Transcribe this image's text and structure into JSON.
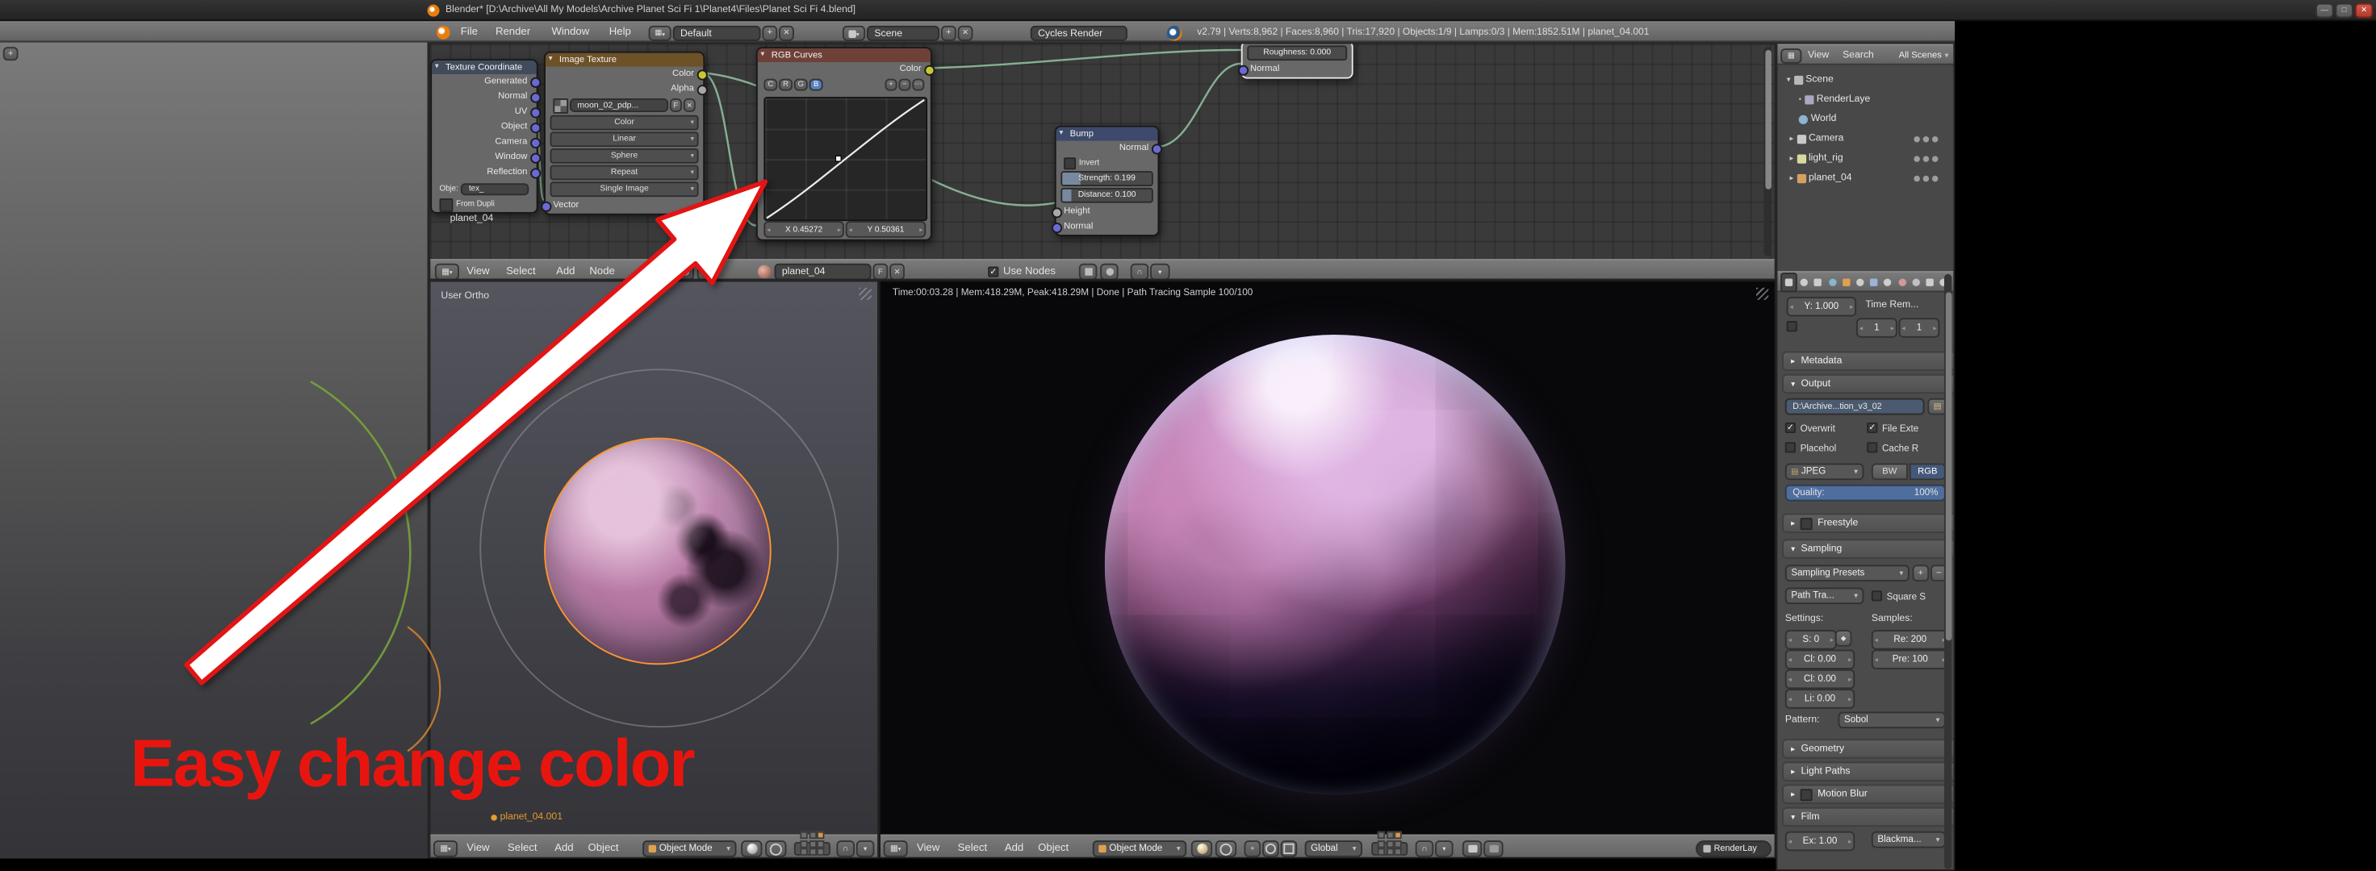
{
  "icons": {
    "close": "✕",
    "plus": "+",
    "minus": "−",
    "check": "✓",
    "minimize": "—",
    "maximize": "□",
    "panel_open": "▼",
    "panel_closed": "►",
    "tri_down": "▾",
    "tri_right": "▸",
    "fake_user": "F",
    "magnet": "∩",
    "dots": "⋯",
    "dot": "•",
    "editor": "▦",
    "folder": "▤",
    "image_file": "▤",
    "seed": "◆",
    "corner": "◢"
  },
  "titlebar": {
    "title": "Blender* [D:\\Archive\\All My Models\\Archive Planet Sci Fi 1\\Planet4\\Files\\Planet Sci Fi 4.blend]"
  },
  "topbar": {
    "menus": [
      "File",
      "Render",
      "Window",
      "Help"
    ],
    "layout": "Default",
    "scene": "Scene",
    "engine": "Cycles Render",
    "stats": "v2.79 | Verts:8,962 | Faces:8,960 | Tris:17,920 | Objects:1/9 | Lamps:0/3 | Mem:1852.51M | planet_04.001"
  },
  "node_editor": {
    "backdrop_label": "planet_04",
    "header": {
      "menus": [
        "View",
        "Select",
        "Add",
        "Node"
      ],
      "material_name": "planet_04",
      "use_nodes": "Use Nodes"
    },
    "nodes": {
      "texture_coordinate": {
        "title": "Texture Coordinate",
        "outputs": [
          "Generated",
          "Normal",
          "UV",
          "Object",
          "Camera",
          "Window",
          "Reflection"
        ],
        "object_label": "Obje:",
        "object_value": "tex_",
        "from_dupli": "From Dupli"
      },
      "image_texture": {
        "title": "Image Texture",
        "outputs": [
          "Color",
          "Alpha"
        ],
        "image_name": "moon_02_pdp...",
        "color_space": "Color",
        "interpolation": "Linear",
        "projection": "Sphere",
        "extension": "Repeat",
        "source": "Single Image",
        "inputs": [
          "Vector"
        ]
      },
      "rgb_curves": {
        "title": "RGB Curves",
        "outputs": [
          "Color"
        ],
        "channels": [
          "C",
          "R",
          "G",
          "B"
        ],
        "x_value": "X 0.45272",
        "y_value": "Y 0.50361"
      },
      "bump": {
        "title": "Bump",
        "outputs": [
          "Normal"
        ],
        "invert": "Invert",
        "strength": "Strength: 0.199",
        "distance": "Distance: 0.100",
        "inputs": [
          "Height",
          "Normal"
        ]
      },
      "shader": {
        "roughness": "Roughness: 0.000",
        "normal": "Normal"
      }
    }
  },
  "viewport_left": {
    "view_label": "User Ortho",
    "object_name": "planet_04.001",
    "header": {
      "menus": [
        "View",
        "Select",
        "Add",
        "Object"
      ],
      "mode": "Object Mode"
    }
  },
  "viewport_render": {
    "render_stats": "Time:00:03.28 | Mem:418.29M, Peak:418.29M | Done | Path Tracing Sample 100/100",
    "header": {
      "menus": [
        "View",
        "Select",
        "Add",
        "Object"
      ],
      "mode": "Object Mode",
      "orientation": "Global",
      "render_layer": "RenderLay"
    }
  },
  "outliner": {
    "menus": [
      "View",
      "Search"
    ],
    "scope": "All Scenes",
    "items": [
      {
        "label": "Scene"
      },
      {
        "label": "RenderLaye"
      },
      {
        "label": "World"
      },
      {
        "label": "Camera"
      },
      {
        "label": "light_rig"
      },
      {
        "label": "planet_04"
      }
    ]
  },
  "properties": {
    "dimensions": {
      "aspect_y": "Y: 1.000",
      "time_remap": "Time Rem...",
      "old": "1",
      "new": "1"
    },
    "panels": {
      "metadata": "Metadata",
      "output": "Output",
      "freestyle": "Freestyle",
      "sampling": "Sampling",
      "geometry": "Geometry",
      "light_paths": "Light Paths",
      "motion_blur": "Motion Blur",
      "film": "Film"
    },
    "output": {
      "path": "D:\\Archive...tion_v3_02",
      "overwrite": "Overwrit",
      "file_extensions": "File Exte",
      "placeholders": "Placehol",
      "cache_result": "Cache R",
      "format": "JPEG",
      "bw": "BW",
      "rgb": "RGB",
      "quality_label": "Quality:",
      "quality_value": "100%"
    },
    "sampling": {
      "presets": "Sampling Presets",
      "integrator": "Path Tra...",
      "square_samples": "Square S",
      "settings_label": "Settings:",
      "samples_label": "Samples:",
      "seed": "S: 0",
      "render_samples": "Re: 200",
      "clamp_direct": "Cl: 0.00",
      "preview_samples": "Pre: 100",
      "clamp_indirect": "Cl: 0.00",
      "light_threshold": "Li: 0.00",
      "pattern_label": "Pattern:",
      "pattern_value": "Sobol"
    },
    "film": {
      "exposure": "Ex: 1.00",
      "filter": "Blackma..."
    }
  },
  "annotation": {
    "text": "Easy change color"
  }
}
